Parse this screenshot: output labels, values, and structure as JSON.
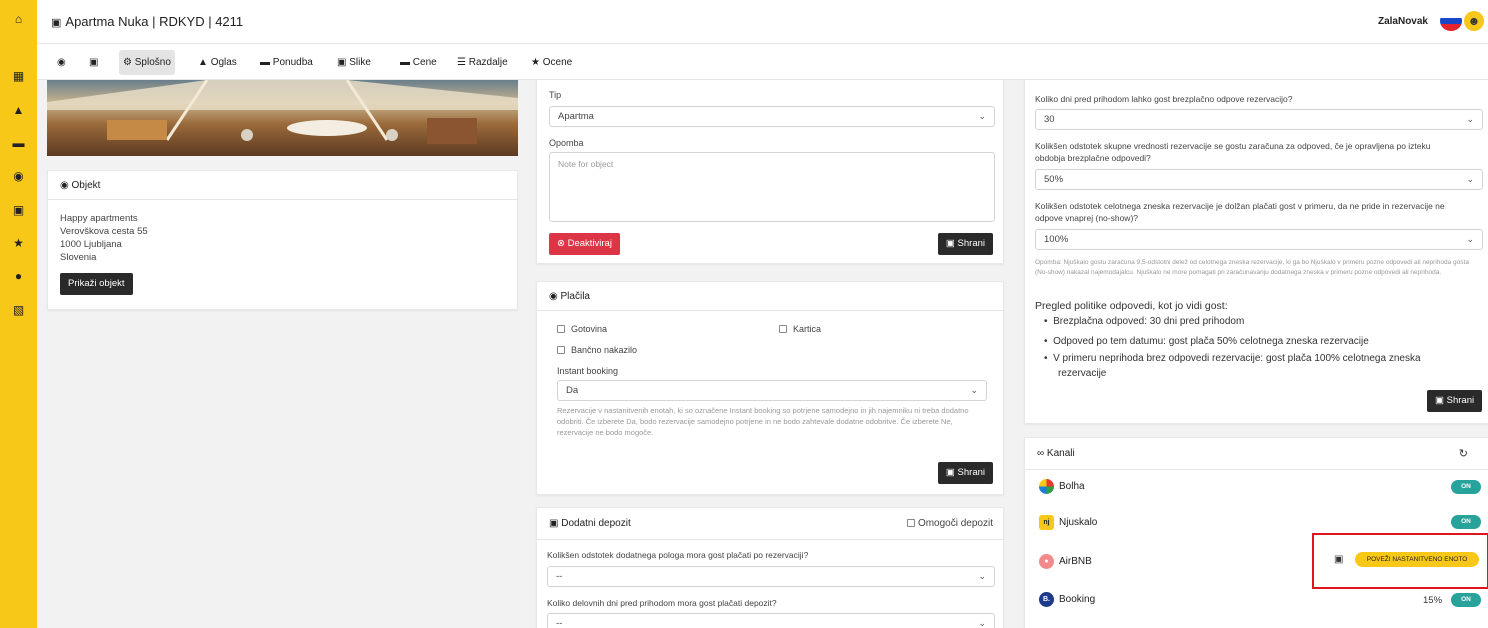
{
  "header": {
    "title": "Apartma Nuka | RDKYD | 4211",
    "user": "ZalaNovak"
  },
  "sidebar": {
    "icons": [
      "home-icon",
      "calendar-icon",
      "home-roof-icon",
      "money-stack-icon",
      "map-marker-icon",
      "door-icon",
      "star-icon",
      "info-icon",
      "clipboard-icon"
    ]
  },
  "nav": {
    "tabs": [
      {
        "label": ""
      },
      {
        "label": ""
      },
      {
        "label": "Splošno"
      },
      {
        "label": "Oglas"
      },
      {
        "label": "Ponudba"
      },
      {
        "label": "Slike"
      },
      {
        "label": "Cene"
      },
      {
        "label": "Razdalje"
      },
      {
        "label": "Ocene"
      }
    ]
  },
  "objekt": {
    "heading": "Objekt",
    "name": "Happy apartments",
    "street": "Verovškova cesta 55",
    "city": "1000 Ljubljana",
    "country": "Slovenia",
    "button": "Prikaži objekt"
  },
  "unit": {
    "tip_label": "Tip",
    "tip_value": "Apartma",
    "opomba_label": "Opomba",
    "opomba_placeholder": "Note for object",
    "deactivate": "Deaktiviraj",
    "save": "Shrani"
  },
  "payments": {
    "heading": "Plačila",
    "cash": "Gotovina",
    "card": "Kartica",
    "bank": "Bančno nakazilo",
    "instant_label": "Instant booking",
    "instant_value": "Da",
    "instant_help": "Rezervacije v nastanitvenih enotah, ki so označene Instant booking so potrjene samodejno in jih najemniku ni treba dodatno odobriti. Če izberete Da, bodo rezervacije samodejno potrjene in ne bodo zahtevale dodatne odobritve. Če izberete Ne, rezervacije ne bodo mogoče.",
    "save": "Shrani"
  },
  "deposit": {
    "heading": "Dodatni depozit",
    "enable": "Omogoči depozit",
    "q1": "Kolikšen odstotek dodatnega pologa mora gost plačati po rezervaciji?",
    "q1_value": "--",
    "q2": "Koliko delovnih dni pred prihodom mora gost plačati depozit?",
    "q2_value": "--"
  },
  "cancellation": {
    "q1": "Koliko dni pred prihodom lahko gost brezplačno odpove rezervacijo?",
    "q1_value": "30",
    "q2_line1": "Kolikšen odstotek skupne vrednosti rezervacije se gostu zaračuna za odpoved, če je opravljena po izteku",
    "q2_line2": "obdobja brezplačne odpovedi?",
    "q2_value": "50%",
    "q3_line1": "Kolikšen odstotek celotnega zneska rezervacije je dolžan plačati gost v primeru, da ne pride in rezervacije ne",
    "q3_line2": "odpove vnaprej (no-show)?",
    "q3_value": "100%",
    "note": "Opomba: Njuškalo gostu zaračuna 9,5-odstotni delež od celotnega zneska rezervacije, ki ga bo Njuškalo v primeru pozne odpovedi ali neprihoda gosta (No-show) nakazal najemodajalcu. Njuškalo ne more pomagati pri zaračunavanju dodatnega zneska v primeru pozne odpovedi ali neprihoda.",
    "summary_title": "Pregled politike odpovedi, kot jo vidi gost:",
    "bullets": [
      "Brezplačna odpoved: 30 dni pred prihodom",
      "Odpoved po tem datumu: gost plača 50% celotnega zneska rezervacije",
      "V primeru neprihoda brez odpovedi rezervacije: gost plača 100% celotnega zneska",
      "rezervacije"
    ],
    "save": "Shrani"
  },
  "channels": {
    "heading": "Kanali",
    "items": [
      {
        "name": "Bolha",
        "status": "ON"
      },
      {
        "name": "Njuskalo",
        "status": "ON"
      },
      {
        "name": "AirBNB",
        "action": "POVEŽI NASTANITVENO ENOTO"
      },
      {
        "name": "Booking",
        "percent": "15%",
        "status": "ON"
      }
    ],
    "logos": {
      "njuskalo": "nj",
      "booking": "B."
    }
  },
  "colors": {
    "accent": "#f7c818",
    "toggle_on": "#27a39c",
    "danger": "#dc3545",
    "highlight_border": "#e0141e"
  }
}
